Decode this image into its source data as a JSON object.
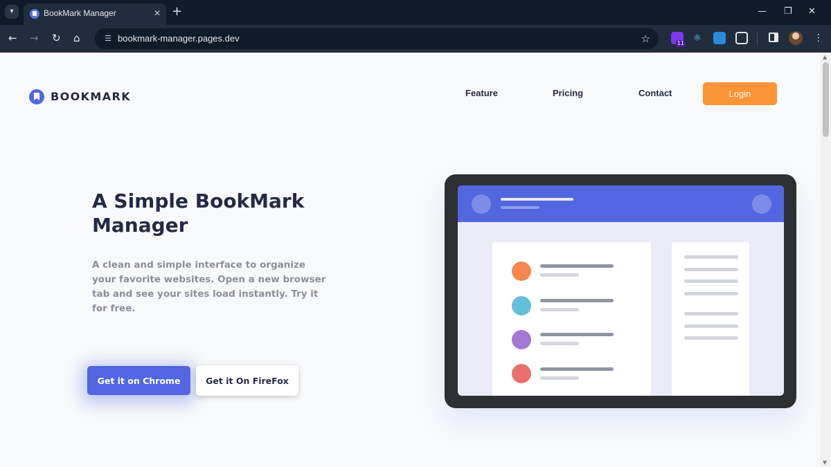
{
  "browser": {
    "tab_title": "BookMark Manager",
    "tab_close": "✕",
    "new_tab": "+",
    "url": "bookmark-manager.pages.dev",
    "window_controls": {
      "minimize": "—",
      "restore": "❐",
      "close": "✕"
    },
    "nav": {
      "back": "←",
      "forward": "→",
      "reload": "↻",
      "home": "⌂"
    },
    "extension_badge": "11"
  },
  "site": {
    "logo_text": "BOOKMARK",
    "nav": [
      "Feature",
      "Pricing",
      "Contact"
    ],
    "login": "Login",
    "hero_title": "A Simple BookMark Manager",
    "hero_desc": "A clean and simple interface to organize your favorite websites. Open a new browser tab and see your sites load instantly. Try it for free.",
    "btn_chrome": "Get it on Chrome",
    "btn_firefox": "Get it On FireFox"
  },
  "colors": {
    "primary": "#5267df",
    "accent": "#fa9437",
    "text_dark": "#242a45",
    "text_muted": "#8a8f9e",
    "list_dots": [
      "#f6874d",
      "#62c0da",
      "#a477d6",
      "#ec6f6f"
    ]
  },
  "icons": [
    "dropdown-icon",
    "bookmark-logo-icon",
    "star-icon",
    "site-info-icon",
    "extensions-icon",
    "side-panel-icon",
    "avatar-icon"
  ]
}
